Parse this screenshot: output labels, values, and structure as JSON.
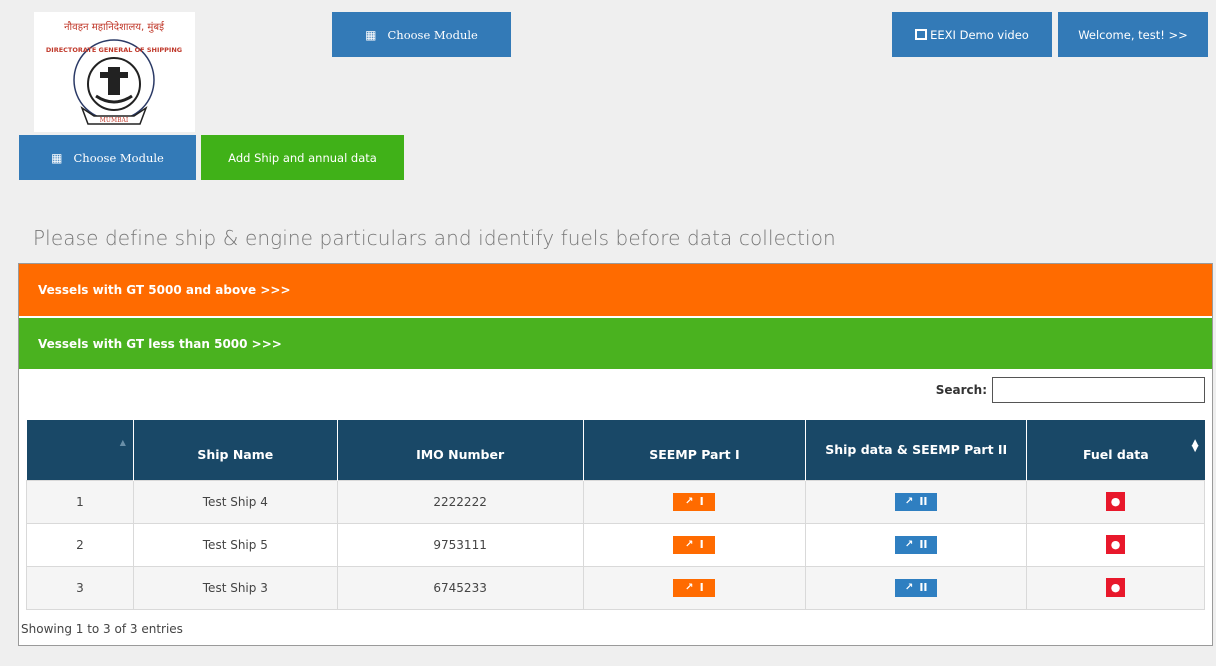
{
  "header": {
    "logo_text_top": "नौवहन महानिदेशालय, मुंबई",
    "logo_text_ring": "DIRECTORATE GENERAL OF SHIPPING",
    "logo_text_banner": "MUMBAI",
    "choose_module_label": "Choose  Module",
    "demo_label": "EEXI Demo video",
    "welcome_label": "Welcome, test! >>"
  },
  "nav": {
    "choose_module_label": "Choose  Module",
    "add_ship_label": "Add Ship and annual data"
  },
  "instruction": "Please define ship & engine particulars and identify fuels before data collection",
  "accordion": {
    "gt_above": "Vessels with GT 5000 and above >>>",
    "gt_below": "Vessels with GT less than 5000 >>>"
  },
  "search": {
    "label": "Search:",
    "value": ""
  },
  "table": {
    "columns": [
      "",
      "Ship Name",
      "IMO Number",
      "SEEMP Part I",
      "Ship data & SEEMP Part II",
      "Fuel data"
    ],
    "rows": [
      {
        "index": "1",
        "ship_name": "Test Ship 4",
        "imo": "2222222",
        "seemp1": "I",
        "seemp2": "II"
      },
      {
        "index": "2",
        "ship_name": "Test Ship 5",
        "imo": "9753111",
        "seemp1": "I",
        "seemp2": "II"
      },
      {
        "index": "3",
        "ship_name": "Test Ship 3",
        "imo": "6745233",
        "seemp1": "I",
        "seemp2": "II"
      }
    ]
  },
  "info": "Showing 1 to 3 of 3 entries",
  "icons": {
    "grid": "th-icon",
    "film": "film-icon",
    "upload": "upload-icon",
    "fuel": "tint-icon",
    "sort_up": "sort-up-icon",
    "sort": "sort-icon"
  },
  "colors": {
    "blue_button": "#337ab7",
    "green_button": "#40b118",
    "orange": "#ff6b00",
    "green_accordion": "#4ab21f",
    "table_header": "#194867",
    "fuel_red": "#e8182b"
  }
}
